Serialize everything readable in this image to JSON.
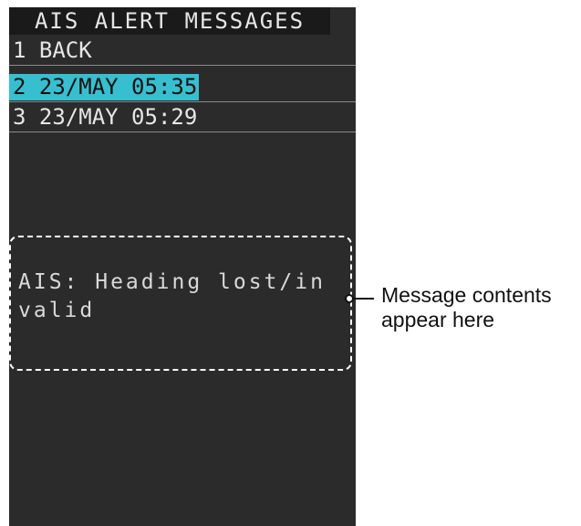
{
  "window": {
    "title": "AIS ALERT MESSAGES"
  },
  "menu": {
    "items": [
      {
        "label": "1 BACK",
        "selected": false
      },
      {
        "label": "2 23/MAY 05:35",
        "selected": true
      },
      {
        "label": "3 23/MAY 05:29",
        "selected": false
      }
    ]
  },
  "message": {
    "line1": "AIS: Heading lost/in",
    "line2": "valid"
  },
  "callout": {
    "line1": "Message contents",
    "line2": "appear here"
  },
  "colors": {
    "panel_background": "#2b2b2b",
    "title_background": "#1a1a1a",
    "selection_highlight": "#37bfcf",
    "text": "#e6e6e6"
  }
}
